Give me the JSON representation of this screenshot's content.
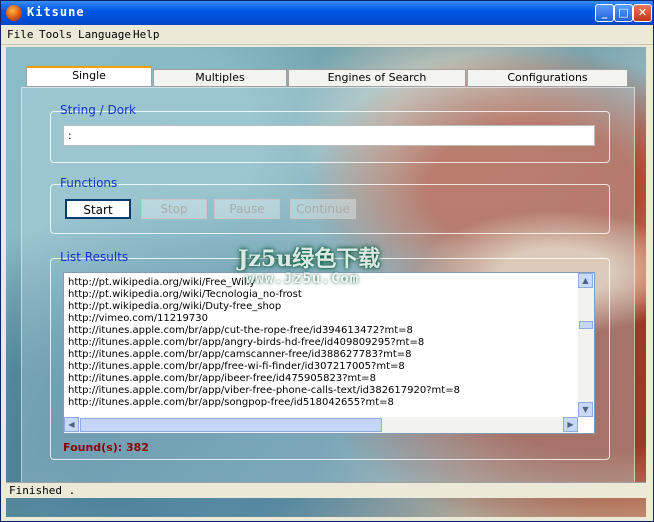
{
  "window": {
    "title": "Kitsune"
  },
  "menu": [
    "File",
    "Tools",
    "Language",
    "Help"
  ],
  "tabs": [
    "Single",
    "Multiples",
    "Engines of Search",
    "Configurations"
  ],
  "string_group": {
    "label": "String / Dork",
    "value": ":"
  },
  "functions_group": {
    "label": "Functions",
    "buttons": [
      "Start",
      "Stop",
      "Pause",
      "Continue"
    ]
  },
  "results_group": {
    "label": "List Results",
    "items": [
      "http://pt.wikipedia.org/wiki/Free_Willy",
      "http://pt.wikipedia.org/wiki/Tecnologia_no-frost",
      "http://pt.wikipedia.org/wiki/Duty-free_shop",
      "http://vimeo.com/11219730",
      "http://itunes.apple.com/br/app/cut-the-rope-free/id394613472?mt=8",
      "http://itunes.apple.com/br/app/angry-birds-hd-free/id409809295?mt=8",
      "http://itunes.apple.com/br/app/camscanner-free/id388627783?mt=8",
      "http://itunes.apple.com/br/app/free-wi-fi-finder/id307217005?mt=8",
      "http://itunes.apple.com/br/app/ibeer-free/id475905823?mt=8",
      "http://itunes.apple.com/br/app/viber-free-phone-calls-text/id382617920?mt=8",
      "http://itunes.apple.com/br/app/songpop-free/id518042655?mt=8"
    ],
    "found_text": "Found(s): 382"
  },
  "status": {
    "text": "Finished ."
  },
  "watermark": {
    "text": "Jz5u绿色下载",
    "url": "www.Jz5u.Com"
  }
}
